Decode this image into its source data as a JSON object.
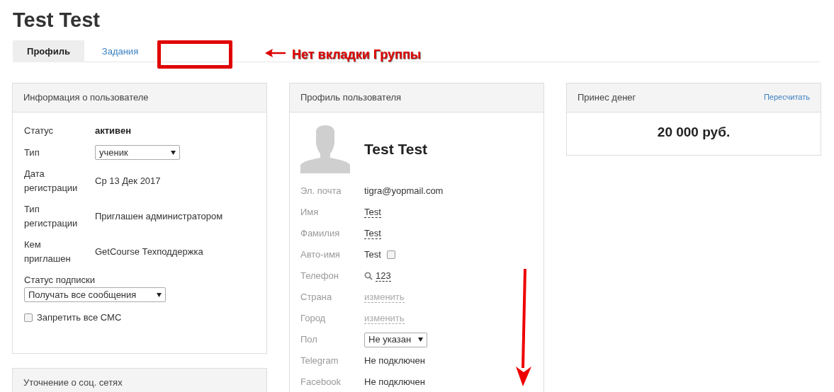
{
  "title": "Test Test",
  "tabs": [
    {
      "label": "Профиль",
      "selected": true
    },
    {
      "label": "Задания",
      "selected": false
    }
  ],
  "annotation": {
    "text": "Нет вкладки Группы"
  },
  "user_info": {
    "title": "Информация о пользователе",
    "rows": [
      {
        "kind": "bold",
        "label": "Статус",
        "value": "активен"
      },
      {
        "kind": "select",
        "label": "Тип",
        "value": "ученик"
      },
      {
        "kind": "text",
        "label": "Дата регистрации",
        "value": "Ср 13 Дек 2017"
      },
      {
        "kind": "text",
        "label": "Тип регистрации",
        "value": "Приглашен администратором"
      },
      {
        "kind": "text",
        "label": "Кем приглашен",
        "value": "GetCourse Техподдержка"
      }
    ],
    "subscription": {
      "label": "Статус подписки",
      "value": "Получать все сообщения"
    },
    "block_sms": {
      "label": "Запретить все СМС",
      "checked": false
    }
  },
  "social_panel": {
    "title": "Уточнение о соц. сетях"
  },
  "profile": {
    "title": "Профиль пользователя",
    "name": "Test Test",
    "rows": [
      {
        "kind": "text",
        "label": "Эл. почта",
        "value": "tigra@yopmail.com"
      },
      {
        "kind": "dashed",
        "label": "Имя",
        "value": "Test"
      },
      {
        "kind": "dashed",
        "label": "Фамилия",
        "value": "Test"
      },
      {
        "kind": "checkbox",
        "label": "Авто-имя",
        "value": "Test",
        "checked": false
      },
      {
        "kind": "phone",
        "label": "Телефон",
        "value": "123"
      },
      {
        "kind": "link",
        "label": "Страна",
        "value": "изменить"
      },
      {
        "kind": "link",
        "label": "Город",
        "value": "изменить"
      },
      {
        "kind": "select",
        "label": "Пол",
        "value": "Не указан"
      },
      {
        "kind": "text",
        "label": "Telegram",
        "value": "Не подключен"
      },
      {
        "kind": "text",
        "label": "Facebook",
        "value": "Не подключен"
      }
    ]
  },
  "revenue": {
    "title": "Принес денег",
    "action": "Пересчитать",
    "amount": "20 000 руб."
  }
}
